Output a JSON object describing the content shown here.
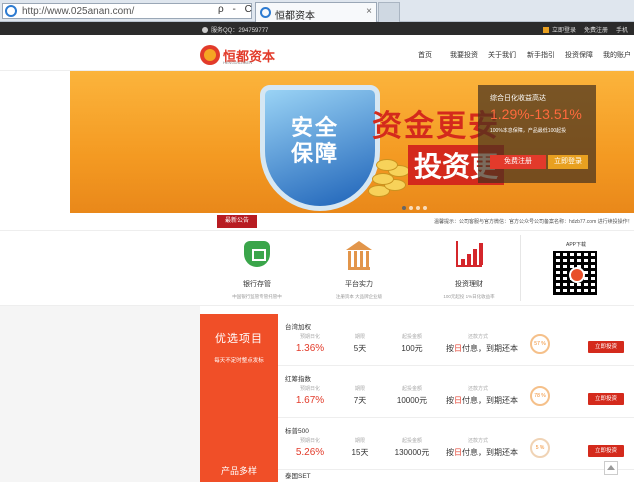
{
  "browser": {
    "url": "http://www.025anan.com/",
    "tab_title": "恒都资本",
    "addr_buttons": "ρ - C",
    "tab_close": "×"
  },
  "topbar": {
    "qq_label": "服务QQ：",
    "qq_number": "294759777",
    "links": [
      "立即登录",
      "免费注册",
      "手机"
    ]
  },
  "header": {
    "logo_text": "恒都资本",
    "logo_sub": "HENGDUZIBEN",
    "nav": [
      "首页",
      "我要投资",
      "关于我们",
      "新手指引",
      "投资保障",
      "我的账户"
    ]
  },
  "banner": {
    "shield_text": "安全保障",
    "slogan1": "资金更安",
    "slogan2": "投资更",
    "rate_label": "综合日化收益高达",
    "rate": "1.29%-13.51%",
    "rate_desc": "100%本息保障，产品最低100起投",
    "register_btn": "免费注册",
    "login_btn": "立即登录"
  },
  "notice": {
    "tag": "最新公告",
    "text": "温馨提示：公司客服与官方微信：官方公众号公司备案名称：hdzb77.com 进行续投操作！"
  },
  "features": [
    {
      "name": "银行存管",
      "sub": "中国银行监管专管托管中"
    },
    {
      "name": "平台实力",
      "sub": "注册资本 大品牌企业级"
    },
    {
      "name": "投资理财",
      "sub": "100元起投 1%日化收益率"
    }
  ],
  "app": {
    "label": "APP下载"
  },
  "promo": {
    "title": "优选项目",
    "subtitle": "每天不定时整点发标",
    "lower": "产品多样"
  },
  "products": [
    {
      "name": "台湾加权",
      "k_rate": "预期日化",
      "rate": "1.36%",
      "k_term": "期限",
      "term": "5天",
      "k_amount": "起投金额",
      "amount": "100元",
      "k_repay": "还款方式",
      "repay_pre": "按",
      "repay_hl": "日",
      "repay_post": "付息，到期还本",
      "progress": "57 %",
      "btn": "立即投资"
    },
    {
      "name": "红筹指数",
      "k_rate": "预期日化",
      "rate": "1.67%",
      "k_term": "期限",
      "term": "7天",
      "k_amount": "起投金额",
      "amount": "10000元",
      "k_repay": "还款方式",
      "repay_pre": "按",
      "repay_hl": "日",
      "repay_post": "付息，到期还本",
      "progress": "78 %",
      "btn": "立即投资"
    },
    {
      "name": "标普500",
      "k_rate": "预期日化",
      "rate": "5.26%",
      "k_term": "期限",
      "term": "15天",
      "k_amount": "起投金额",
      "amount": "130000元",
      "k_repay": "还款方式",
      "repay_pre": "按",
      "repay_hl": "日",
      "repay_post": "付息，到期还本",
      "progress": "5 %",
      "btn": "立即投资"
    }
  ],
  "product4_name": "泰国SET"
}
